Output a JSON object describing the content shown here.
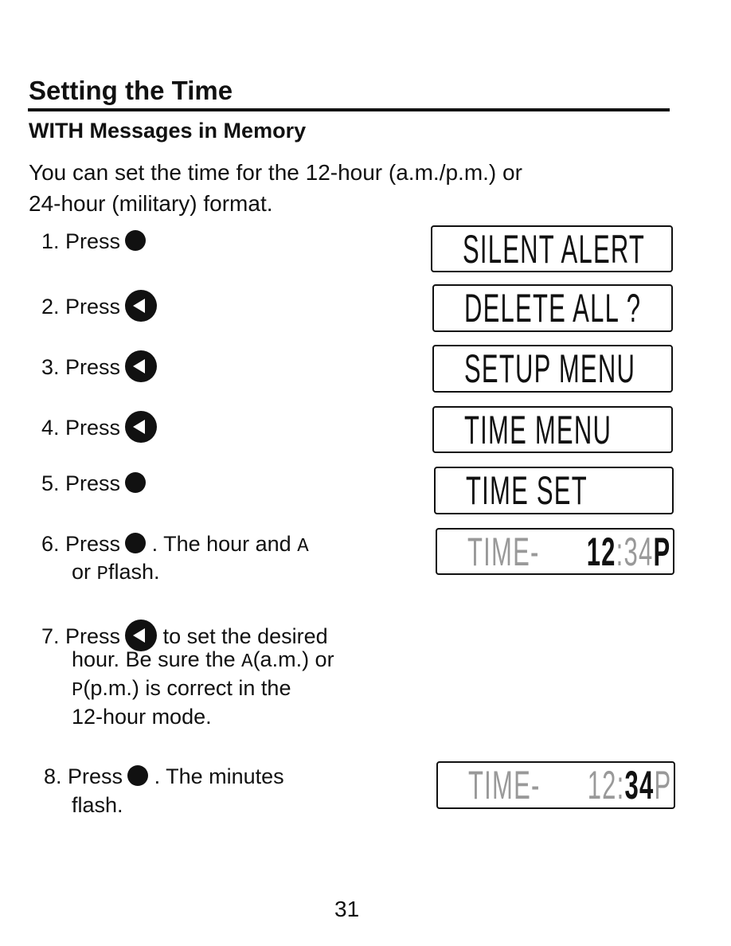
{
  "title": "Setting the Time",
  "subtitle": "WITH Messages in Memory",
  "intro": [
    "You can set the time for the 12-hour (a.m./p.m.) or",
    "24-hour (military) format."
  ],
  "steps": [
    {
      "num": "1. Press",
      "icon": "filled-circle-button"
    },
    {
      "num": "2. Press",
      "icon": "left-arrow-button"
    },
    {
      "num": "3. Press",
      "icon": "left-arrow-button"
    },
    {
      "num": "4. Press",
      "icon": "left-arrow-button"
    },
    {
      "num": "5. Press",
      "icon": "filled-circle-button"
    },
    {
      "num": "6. Press",
      "icon": "filled-circle-button",
      "after": ". The hour and",
      "a": "A",
      "line2_pre": "or",
      "p": "P",
      "line2_post": "flash."
    },
    {
      "num": "7. Press",
      "icon": "left-arrow-button",
      "after": "to set the desired",
      "line2_pre": "hour. Be sure the",
      "a": "A",
      "line2_post": "(a.m.) or",
      "p": "P",
      "line3_post": "(p.m.) is correct in the",
      "line4": "12-hour mode."
    },
    {
      "num": "8. Press",
      "icon": "filled-circle-button",
      "after": ". The minutes",
      "line2": "flash."
    }
  ],
  "displays": [
    "SILENT ALERT",
    "DELETE ALL ?",
    "SETUP MENU",
    "TIME MENU",
    "TIME SET",
    {
      "label": "TIME-",
      "hour": "12",
      "sep": ":",
      "min": "34",
      "ampm": "P"
    },
    {
      "label": "TIME-",
      "hour": "12",
      "sep": ":",
      "min": "34",
      "ampm": "P"
    }
  ],
  "page_number": "31"
}
